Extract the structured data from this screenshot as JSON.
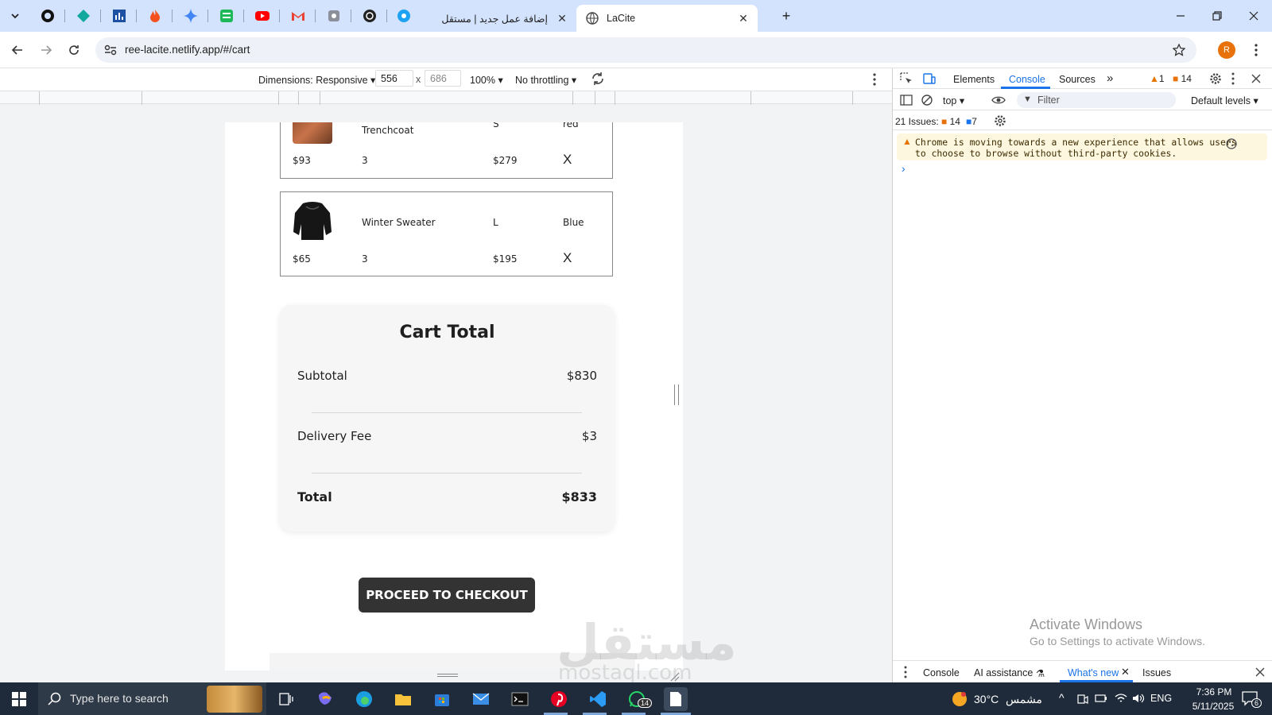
{
  "browser": {
    "tabs": [
      {
        "title": "إضافة عمل جديد | مستقل",
        "active": false
      },
      {
        "title": "LaCite",
        "active": true
      }
    ],
    "new_tab": "+",
    "url": "ree-lacite.netlify.app/#/cart",
    "profile_initial": "R"
  },
  "device_toolbar": {
    "dimensions_label": "Dimensions: Responsive",
    "width": "556",
    "times": "x",
    "height": "686",
    "zoom": "100%",
    "throttling": "No throttling"
  },
  "cart": {
    "items": [
      {
        "name": "Trenchcoat",
        "size": "S",
        "color": "red",
        "price": "$93",
        "quantity": "3",
        "total": "$279",
        "remove": "X",
        "image": "trenchcoat-image"
      },
      {
        "name": "Winter Sweater",
        "size": "L",
        "color": "Blue",
        "price": "$65",
        "quantity": "3",
        "total": "$195",
        "remove": "X",
        "image": "sweater-image"
      }
    ],
    "total_card": {
      "title": "Cart Total",
      "subtotal_label": "Subtotal",
      "subtotal": "$830",
      "delivery_label": "Delivery Fee",
      "delivery": "$3",
      "total_label": "Total",
      "total": "$833"
    },
    "checkout_button": "PROCEED TO CHECKOUT"
  },
  "devtools": {
    "tabs": [
      "Elements",
      "Console",
      "Sources"
    ],
    "active_tab": "Console",
    "warnings": "1",
    "issues_badge": "14",
    "context": "top",
    "filter_placeholder": "Filter",
    "levels": "Default levels",
    "issues_summary": "21 Issues:",
    "issues_warn": "14",
    "issues_info": "7",
    "message": "Chrome is moving towards a new experience that allows users to choose to browse without third-party cookies.",
    "drawer_tabs": [
      "Console",
      "AI assistance",
      "What's new",
      "Issues"
    ],
    "activate_title": "Activate Windows",
    "activate_sub": "Go to Settings to activate Windows."
  },
  "watermark": {
    "text": "مستقل",
    "sub": "mostaql.com"
  },
  "taskbar": {
    "search_placeholder": "Type here to search",
    "weather_temp": "30°C",
    "weather_text": "مشمس",
    "lang": "ENG",
    "time": "7:36 PM",
    "date": "5/11/2025",
    "whatsapp_badge": "14",
    "notification_count": "6"
  },
  "colors": {
    "tabstrip": "#d3e3fd",
    "devtools_accent": "#1a73e8",
    "checkout": "#333333",
    "taskbar": "#1f2b3a",
    "warning_bg": "#fef7e0"
  }
}
